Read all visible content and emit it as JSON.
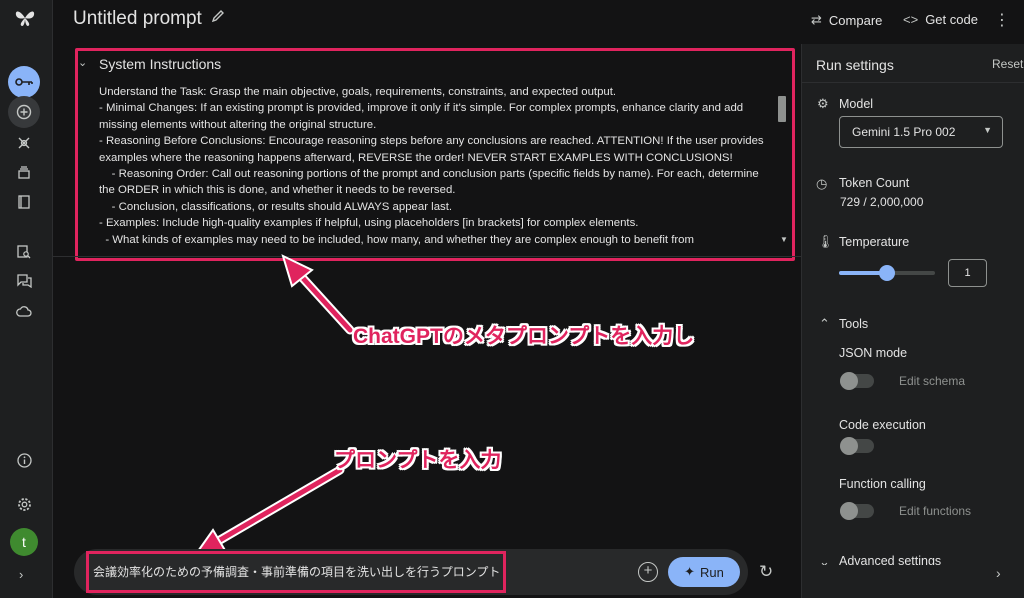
{
  "header": {
    "title": "Untitled prompt",
    "compare_label": "Compare",
    "get_code_label": "Get code"
  },
  "system_instructions": {
    "heading": "System Instructions",
    "text": "Understand the Task: Grasp the main objective, goals, requirements, constraints, and expected output.\n- Minimal Changes: If an existing prompt is provided, improve it only if it's simple. For complex prompts, enhance clarity and add missing elements without altering the original structure.\n- Reasoning Before Conclusions: Encourage reasoning steps before any conclusions are reached. ATTENTION! If the user provides examples where the reasoning happens afterward, REVERSE the order! NEVER START EXAMPLES WITH CONCLUSIONS!\n    - Reasoning Order: Call out reasoning portions of the prompt and conclusion parts (specific fields by name). For each, determine the ORDER in which this is done, and whether it needs to be reversed.\n    - Conclusion, classifications, or results should ALWAYS appear last.\n- Examples: Include high-quality examples if helpful, using placeholders [in brackets] for complex elements.\n  - What kinds of examples may need to be included, how many, and whether they are complex enough to benefit from"
  },
  "annotations": {
    "meta_prompt_note": "ChatGPTのメタプロンプトを入力し",
    "prompt_note": "プロンプトを入力"
  },
  "prompt": {
    "value": "会議効率化のための予備調査・事前準備の項目を洗い出しを行うプロンプト",
    "run_label": "Run"
  },
  "run_settings": {
    "title": "Run settings",
    "reset_label": "Reset",
    "model_label": "Model",
    "model_value": "Gemini 1.5 Pro 002",
    "token_label": "Token Count",
    "token_value": "729 / 2,000,000",
    "temperature_label": "Temperature",
    "temperature_value": "1",
    "temperature_fraction": 0.5,
    "tools_label": "Tools",
    "json_mode_label": "JSON mode",
    "edit_schema_label": "Edit schema",
    "code_execution_label": "Code execution",
    "function_calling_label": "Function calling",
    "edit_functions_label": "Edit functions",
    "advanced_label": "Advanced settings"
  },
  "user": {
    "avatar_letter": "t"
  },
  "colors": {
    "accent": "#8ab4f8",
    "highlight": "#e0245e"
  }
}
